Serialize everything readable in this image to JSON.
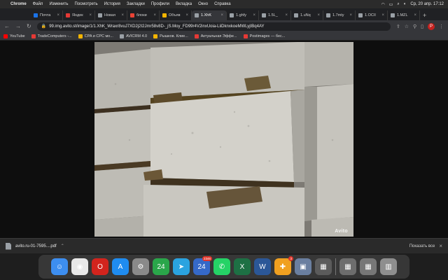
{
  "menubar": {
    "app": "Chrome",
    "items": [
      "Файл",
      "Изменить",
      "Посмотреть",
      "История",
      "Закладки",
      "Профили",
      "Вкладка",
      "Окно",
      "Справка"
    ],
    "clock": "Ср, 20 апр.  17:12"
  },
  "tabs": [
    {
      "label": "Почта",
      "color": "#1a73e8"
    },
    {
      "label": "Яндек",
      "color": "#e53935"
    },
    {
      "label": "Новая",
      "color": "#9aa0a6"
    },
    {
      "label": "блоки",
      "color": "#ea4335"
    },
    {
      "label": "Объяв",
      "color": "#f4b400"
    },
    {
      "label": "1.XhK",
      "color": "#9aa0a6",
      "active": true
    },
    {
      "label": "1.ghfy",
      "color": "#9aa0a6"
    },
    {
      "label": "1.5L_",
      "color": "#9aa0a6"
    },
    {
      "label": "1.uNq",
      "color": "#9aa0a6"
    },
    {
      "label": "1.7mty",
      "color": "#9aa0a6"
    },
    {
      "label": "1.OCII",
      "color": "#9aa0a6"
    },
    {
      "label": "1.MZL",
      "color": "#9aa0a6"
    }
  ],
  "omnibox": {
    "url": "99.img.avito.st/image/1/1.XhK_Wraxr8vuJ7XD2j2I2Jmr58v8D-_jS.Moy_FD99r4V2inxUoia-LiiDknxkoeMWLyjIBq4AY"
  },
  "bookmarks": [
    {
      "label": "YouTube",
      "color": "#ff0000"
    },
    {
      "label": "TradeComputers -...",
      "color": "#e53935"
    },
    {
      "label": "CPA и CPC мо...",
      "color": "#f4b400"
    },
    {
      "label": "AVICRM 4.0",
      "color": "#9aa0a6"
    },
    {
      "label": "Рышков. Клие...",
      "color": "#f4b400"
    },
    {
      "label": "Актуальная Эффе...",
      "color": "#e53935"
    },
    {
      "label": "Postimages — бес...",
      "color": "#e53935"
    }
  ],
  "photo": {
    "watermark": "Avito"
  },
  "downloads": {
    "filename": "avito.ru-01-7595....pdf",
    "show_all": "Показать все"
  },
  "dock": [
    {
      "name": "finder",
      "glyph": "☺",
      "color": "#3d8ef0"
    },
    {
      "name": "chrome",
      "glyph": "◉",
      "color": "#e8e8e8"
    },
    {
      "name": "opera",
      "glyph": "O",
      "color": "#d2241d"
    },
    {
      "name": "app-store",
      "glyph": "A",
      "color": "#1f8cf0"
    },
    {
      "name": "system-preferences",
      "glyph": "⚙",
      "color": "#8a8a8a"
    },
    {
      "name": "calendar-24-a",
      "glyph": "24",
      "color": "#2aa64a"
    },
    {
      "name": "telegram",
      "glyph": "➤",
      "color": "#2aa3e0"
    },
    {
      "name": "calendar-24-b",
      "glyph": "24",
      "color": "#3569c8",
      "badge": "2346"
    },
    {
      "name": "whatsapp",
      "glyph": "✆",
      "color": "#25d366"
    },
    {
      "name": "excel",
      "glyph": "X",
      "color": "#1d7044"
    },
    {
      "name": "word",
      "glyph": "W",
      "color": "#2b5797"
    },
    {
      "name": "app-multi",
      "glyph": "✚",
      "color": "#f0a020",
      "badge": "3"
    },
    {
      "name": "preview",
      "glyph": "▣",
      "color": "#6a7fa0"
    },
    {
      "name": "photos-a",
      "glyph": "▦",
      "color": "#5b5b5b"
    },
    {
      "name": "photos-b",
      "glyph": "▦",
      "color": "#6d6d6d"
    },
    {
      "name": "photos-c",
      "glyph": "▦",
      "color": "#777777"
    },
    {
      "name": "trash",
      "glyph": "▥",
      "color": "#8e8e8e"
    }
  ],
  "colors": {
    "accent": "#35363a",
    "tabstrip": "#202124"
  }
}
